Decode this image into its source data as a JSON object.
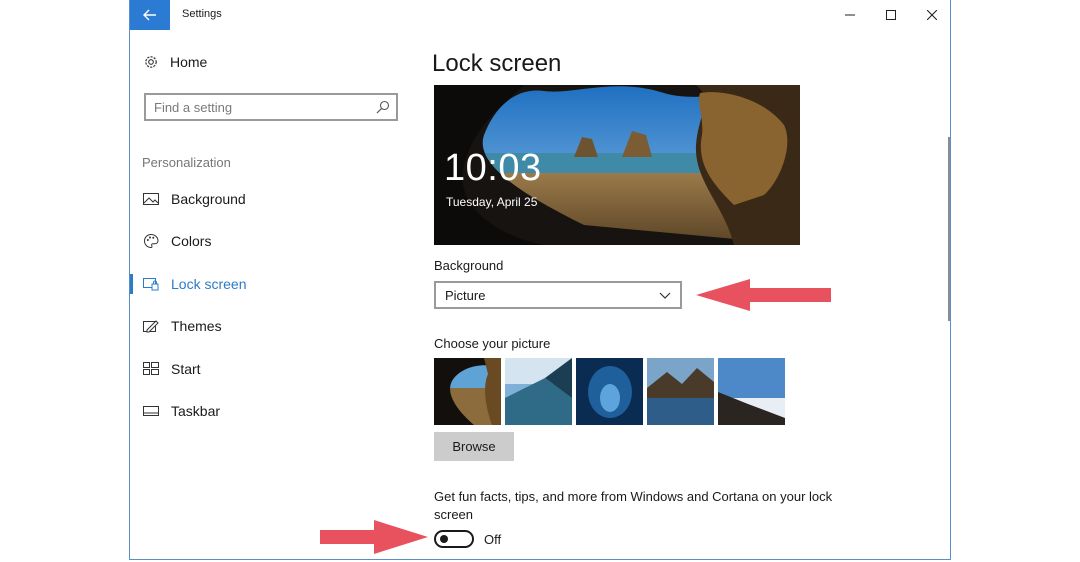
{
  "window": {
    "title": "Settings"
  },
  "nav": {
    "home_label": "Home",
    "search_placeholder": "Find a setting",
    "section_header": "Personalization",
    "items": [
      {
        "label": "Background",
        "icon": "picture-icon"
      },
      {
        "label": "Colors",
        "icon": "palette-icon"
      },
      {
        "label": "Lock screen",
        "icon": "lock-screen-icon",
        "active": true
      },
      {
        "label": "Themes",
        "icon": "themes-icon"
      },
      {
        "label": "Start",
        "icon": "start-icon"
      },
      {
        "label": "Taskbar",
        "icon": "taskbar-icon"
      }
    ]
  },
  "main": {
    "title": "Lock screen",
    "preview": {
      "time": "10:03",
      "date": "Tuesday, April 25"
    },
    "background_label": "Background",
    "background_value": "Picture",
    "choose_label": "Choose your picture",
    "browse_label": "Browse",
    "funfacts_text": "Get fun facts, tips, and more from Windows and Cortana on your lock screen",
    "toggle_state": "Off"
  },
  "colors": {
    "accent": "#2d7cc6",
    "titlebar_back": "#2b7ad4",
    "arrow": "#e8525f"
  }
}
